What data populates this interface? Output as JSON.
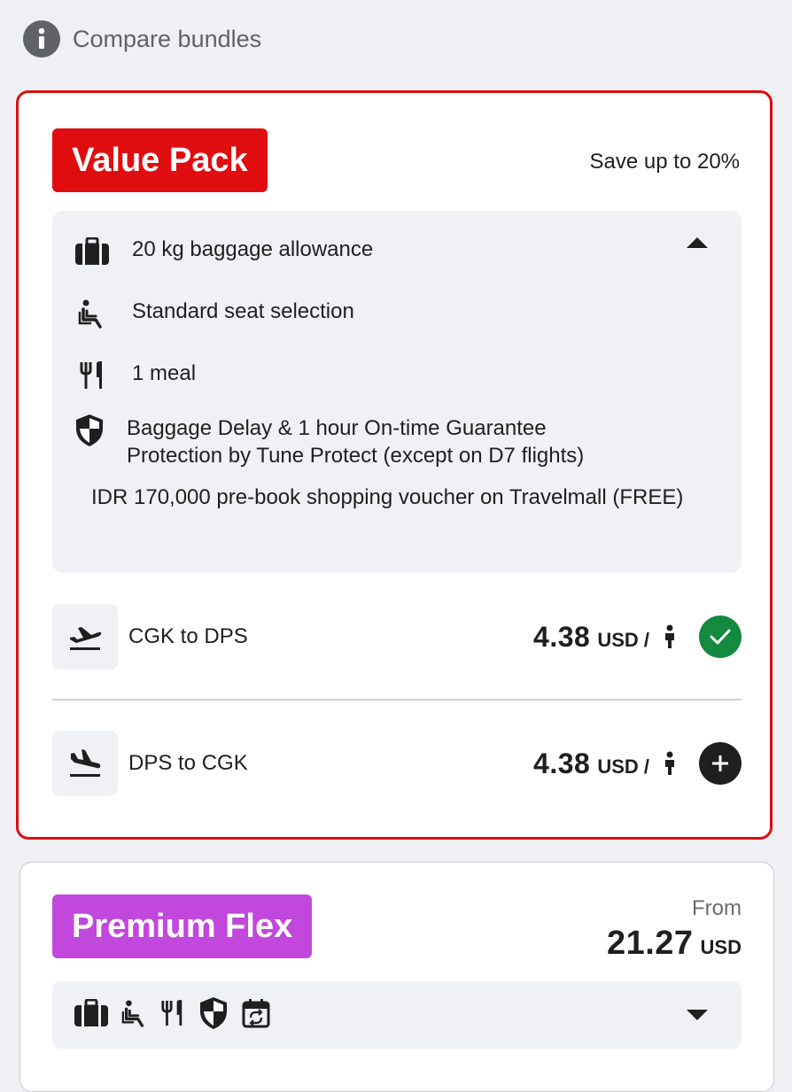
{
  "header": {
    "compare_label": "Compare bundles",
    "icon": "info-icon"
  },
  "value_pack": {
    "badge": "Value Pack",
    "badge_color": "#e00d10",
    "save_text": "Save up to 20%",
    "features": [
      {
        "icon": "suitcase-icon",
        "text": "20 kg baggage allowance"
      },
      {
        "icon": "seat-icon",
        "text": "Standard seat selection"
      },
      {
        "icon": "meal-icon",
        "text": "1 meal"
      },
      {
        "icon": "shield-icon",
        "text": "Baggage Delay & 1 hour On-time Guarantee Protection by Tune Protect (except on D7 flights)"
      }
    ],
    "voucher": "IDR 170,000 pre-book shopping voucher on Travelmall (FREE)",
    "routes": [
      {
        "label": "CGK to DPS",
        "price": "4.38",
        "unit": "USD /",
        "status": "selected",
        "status_color": "#138a3f"
      },
      {
        "label": "DPS to CGK",
        "price": "4.38",
        "unit": "USD /",
        "status": "add",
        "status_color": "#1f1f1f"
      }
    ]
  },
  "premium_flex": {
    "badge": "Premium Flex",
    "badge_color": "#c247dc",
    "from_label": "From",
    "price": "21.27",
    "unit": "USD",
    "icons": [
      "suitcase-icon",
      "seat-icon",
      "meal-icon",
      "shield-icon",
      "calendar-change-icon"
    ]
  }
}
